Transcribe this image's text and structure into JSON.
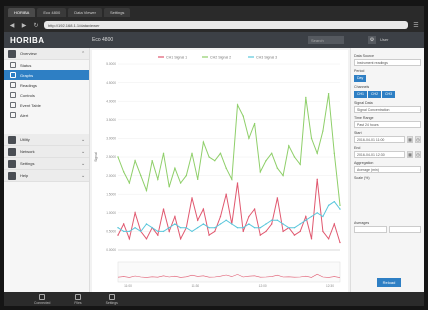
{
  "browser": {
    "tabs": [
      "HORIBA",
      "Eco 4800",
      "Data Viewer",
      "Settings",
      "",
      "",
      ""
    ],
    "address": "http://192.168.1.1/dataviewer",
    "nav_icons": [
      "back-icon",
      "forward-icon",
      "reload-icon",
      "home-icon"
    ]
  },
  "header": {
    "brand": "HORIBA",
    "device": "Eco 4800",
    "search_placeholder": "Search",
    "user": "User"
  },
  "sidebar": {
    "groups": [
      {
        "label": "Overview",
        "items": [
          {
            "label": "Status"
          },
          {
            "label": "Graphs",
            "selected": true
          },
          {
            "label": "Readings"
          },
          {
            "label": "Controls"
          },
          {
            "label": "Event Table"
          },
          {
            "label": "Alert"
          }
        ]
      },
      {
        "label": "Utility"
      },
      {
        "label": "Network"
      },
      {
        "label": "Settings"
      },
      {
        "label": "Help"
      }
    ]
  },
  "chart_data": {
    "type": "line",
    "legend": [
      "CH1 Signal 1",
      "CH2 Signal 2",
      "CH3 Signal 3"
    ],
    "colors": [
      "#e0586f",
      "#8fcf6a",
      "#5bc7dc"
    ],
    "ylabel": "Signal",
    "ylim": [
      0,
      5.0
    ],
    "yticks": [
      "5.0000",
      "4.5000",
      "4.0000",
      "3.5000",
      "3.0000",
      "2.5000",
      "2.0000",
      "1.5000",
      "1.0000",
      "0.5000",
      "0.0000"
    ],
    "overview_ticks": [
      "11:00",
      "11:30",
      "12:00",
      "12:30"
    ],
    "series": [
      {
        "name": "CH1 Signal 1",
        "values": [
          0.4,
          0.7,
          0.3,
          1.0,
          0.5,
          0.3,
          0.6,
          0.4,
          1.1,
          0.5,
          0.9,
          0.3,
          0.6,
          1.4,
          0.8,
          1.1,
          0.4,
          0.5,
          0.9,
          1.5,
          0.7,
          1.8,
          0.5,
          0.9,
          1.1,
          0.4,
          0.5,
          0.7,
          1.4,
          0.5,
          0.6,
          0.4,
          0.5,
          0.9,
          0.3,
          1.9,
          0.5,
          0.3,
          0.7,
          0.2
        ]
      },
      {
        "name": "CH2 Signal 2",
        "values": [
          2.5,
          2.1,
          1.8,
          2.4,
          2.0,
          1.6,
          2.4,
          1.9,
          2.6,
          1.7,
          2.2,
          1.8,
          2.0,
          2.6,
          1.9,
          2.9,
          2.5,
          2.4,
          2.6,
          2.2,
          1.9,
          3.9,
          3.6,
          3.0,
          3.4,
          2.1,
          2.4,
          2.6,
          2.2,
          2.0,
          2.8,
          2.5,
          2.3,
          4.1,
          3.0,
          2.6,
          3.2,
          4.2,
          2.6,
          1.2
        ]
      },
      {
        "name": "CH3 Signal 3",
        "values": [
          0.6,
          0.5,
          0.5,
          0.6,
          0.5,
          0.7,
          0.6,
          0.5,
          0.5,
          0.6,
          0.7,
          0.6,
          0.6,
          0.5,
          0.6,
          0.7,
          0.6,
          0.6,
          0.7,
          0.8,
          0.7,
          0.6,
          0.6,
          0.7,
          0.6,
          0.6,
          0.7,
          0.8,
          0.8,
          0.7,
          0.6,
          0.6,
          0.7,
          0.8,
          0.9,
          1.0,
          0.9,
          1.2,
          1.3,
          1.1
        ]
      }
    ]
  },
  "right_panel": {
    "data_source_label": "Data Source",
    "data_source_value": "Instrument readings",
    "period_label": "Period",
    "period_value": "Day",
    "channels_label": "Channels",
    "channels": [
      "CH1",
      "CH2",
      "CH3"
    ],
    "signal_label": "Signal Data",
    "signal_value": "Signal Concentration",
    "time_range_label": "Time Range",
    "time_range_value": "Past 24 hours",
    "start_label": "Start",
    "start_value": "2016-04-01 11:00",
    "end_label": "End",
    "end_value": "2016-04-01 12:30",
    "aggregation_label": "Aggregation",
    "aggregation_value": "Average (min)",
    "scale_label": "Scale (%)",
    "averages_label": "Averages",
    "reload_label": "Reload"
  },
  "taskbar": {
    "status": "Connected",
    "items": [
      "Files",
      "Settings"
    ]
  }
}
